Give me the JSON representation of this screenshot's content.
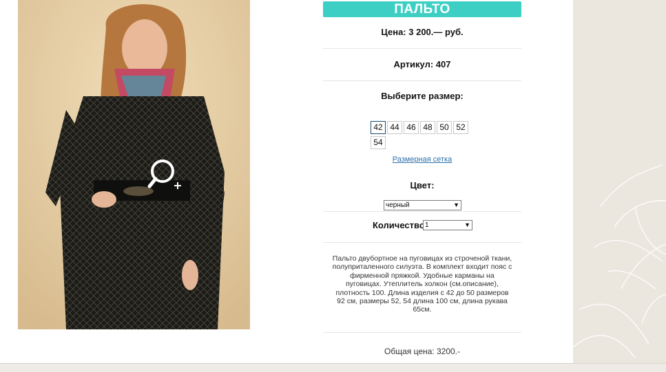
{
  "product": {
    "title": "ПАЛЬТО",
    "price_text": "Цена: 3 200.— руб.",
    "article_text": "Артикул: 407",
    "size_heading": "Выберите размер:",
    "sizes": [
      "42",
      "44",
      "46",
      "48",
      "50",
      "52",
      "54"
    ],
    "selected_size": "42",
    "size_chart_link": "Размерная сетка",
    "color_heading": "Цвет:",
    "color_value": "черный",
    "quantity_label": "Количество:",
    "quantity_value": "1",
    "description": "Пальто двубортное на пуговицах из строченой ткани, полуприталенного силуэта. В комплект входит пояс с фирменной пряжкой. Удобные карманы на пуговицах. Утеплитель холкон (см.описание), плотность 100. Длина изделия с 42 до 50 размеров 92 см, размеры 52, 54 длина 100 см, длина рукава 65см.",
    "total_text": "Общая цена: 3200.-"
  },
  "icons": {
    "zoom": "zoom-in-icon",
    "dropdown": "chevron-down-icon"
  },
  "colors": {
    "title_bar": "#3ecfc4",
    "link": "#2a6fa8",
    "selected_size_border": "#1c4d6e"
  }
}
